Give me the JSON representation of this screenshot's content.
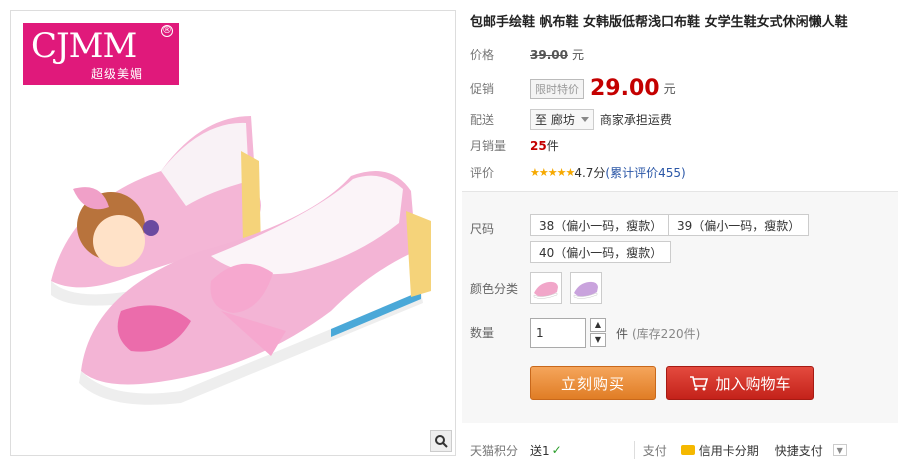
{
  "brand": {
    "logo_text": "CJMM",
    "reg_mark": "®",
    "logo_sub": "超级美媚"
  },
  "product": {
    "title": "包邮手绘鞋 帆布鞋 女韩版低帮浅口布鞋 女学生鞋女式休闲懒人鞋"
  },
  "price": {
    "label": "价格",
    "original": "39.00",
    "unit": "元"
  },
  "promo": {
    "label": "促销",
    "tag": "限时特价",
    "price": "29.00",
    "unit": "元"
  },
  "delivery": {
    "label": "配送",
    "location": "至 廊坊",
    "note": "商家承担运费"
  },
  "sales": {
    "label": "月销量",
    "count": "25",
    "unit": "件"
  },
  "rating": {
    "label": "评价",
    "stars": "★★★★★",
    "score": "4.7分",
    "reviews": "(累计评价455)"
  },
  "size": {
    "label": "尺码",
    "options": [
      "38（偏小一码，瘦款）",
      "39（偏小一码，瘦款）",
      "40（偏小一码，瘦款）"
    ]
  },
  "color": {
    "label": "颜色分类"
  },
  "quantity": {
    "label": "数量",
    "value": "1",
    "unit": "件",
    "stock": "(库存220件)"
  },
  "actions": {
    "buy": "立刻购买",
    "cart": "加入购物车"
  },
  "footer": {
    "points_label": "天猫积分",
    "points_value": "送1",
    "pay_label": "支付",
    "credit": "信用卡分期",
    "quick_pay": "快捷支付"
  }
}
